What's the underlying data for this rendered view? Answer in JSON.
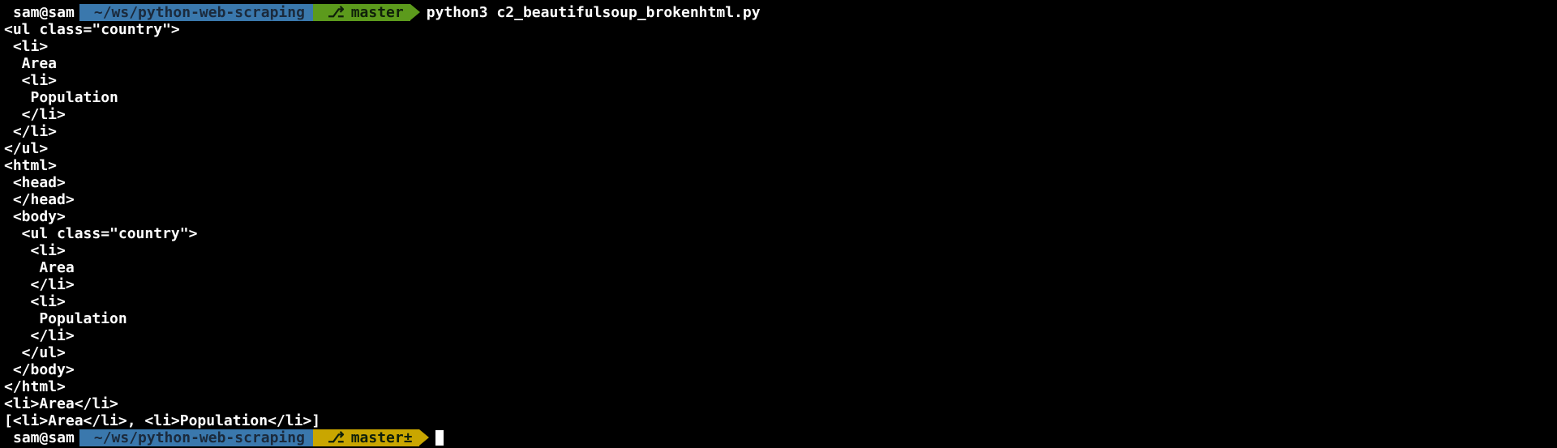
{
  "colors": {
    "background": "#000000",
    "text": "#ffffff",
    "path_segment": "#3a78ad",
    "branch_clean": "#5c9a1c",
    "branch_dirty": "#c9a600"
  },
  "prompt1": {
    "user": "sam@sam",
    "path": "~/ws/python-web-scraping",
    "branch": "master",
    "branch_icon": "git-branch-icon",
    "command": "python3 c2_beautifulsoup_brokenhtml.py"
  },
  "output": [
    "<ul class=\"country\">",
    " <li>",
    "  Area",
    "  <li>",
    "   Population",
    "  </li>",
    " </li>",
    "</ul>",
    "<html>",
    " <head>",
    " </head>",
    " <body>",
    "  <ul class=\"country\">",
    "   <li>",
    "    Area",
    "   </li>",
    "   <li>",
    "    Population",
    "   </li>",
    "  </ul>",
    " </body>",
    "</html>",
    "<li>Area</li>",
    "[<li>Area</li>, <li>Population</li>]"
  ],
  "prompt2": {
    "user": "sam@sam",
    "path": "~/ws/python-web-scraping",
    "branch": "master±",
    "branch_icon": "git-branch-icon"
  }
}
